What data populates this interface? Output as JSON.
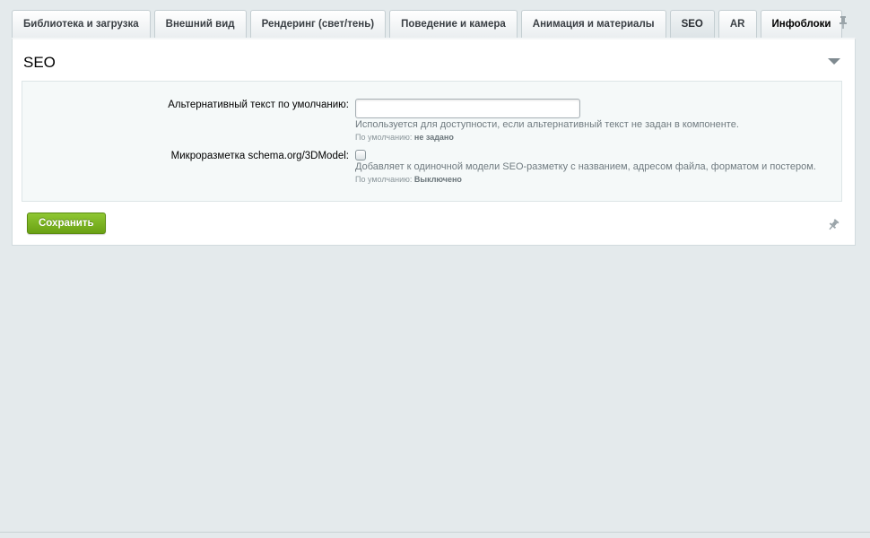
{
  "tabs": [
    {
      "label": "Библиотека и загрузка",
      "active": false
    },
    {
      "label": "Внешний вид",
      "active": false
    },
    {
      "label": "Рендеринг (свет/тень)",
      "active": false
    },
    {
      "label": "Поведение и камера",
      "active": false
    },
    {
      "label": "Анимация и материалы",
      "active": false
    },
    {
      "label": "SEO",
      "active": true
    },
    {
      "label": "AR",
      "active": false
    },
    {
      "label": "Инфоблоки",
      "active": false
    }
  ],
  "panel": {
    "title": "SEO"
  },
  "fields": {
    "alt_text": {
      "label": "Альтернативный текст по умолчанию:",
      "value": "",
      "hint": "Используется для доступности, если альтернативный текст не задан в компоненте.",
      "default_prefix": "По умолчанию:",
      "default_value": "не задано"
    },
    "schema": {
      "label": "Микроразметка schema.org/3DModel:",
      "checked": false,
      "hint": "Добавляет к одиночной модели SEO-разметку с названием, адресом файла, форматом и постером.",
      "default_prefix": "По умолчанию:",
      "default_value": "Выключено"
    }
  },
  "actions": {
    "save_label": "Сохранить"
  },
  "icons": {
    "pin": "pin-icon",
    "collapse": "chevron-down-icon"
  },
  "colors": {
    "background": "#e4eaec",
    "save_button": "#78b31e",
    "form_box": "#f5f9f9"
  }
}
